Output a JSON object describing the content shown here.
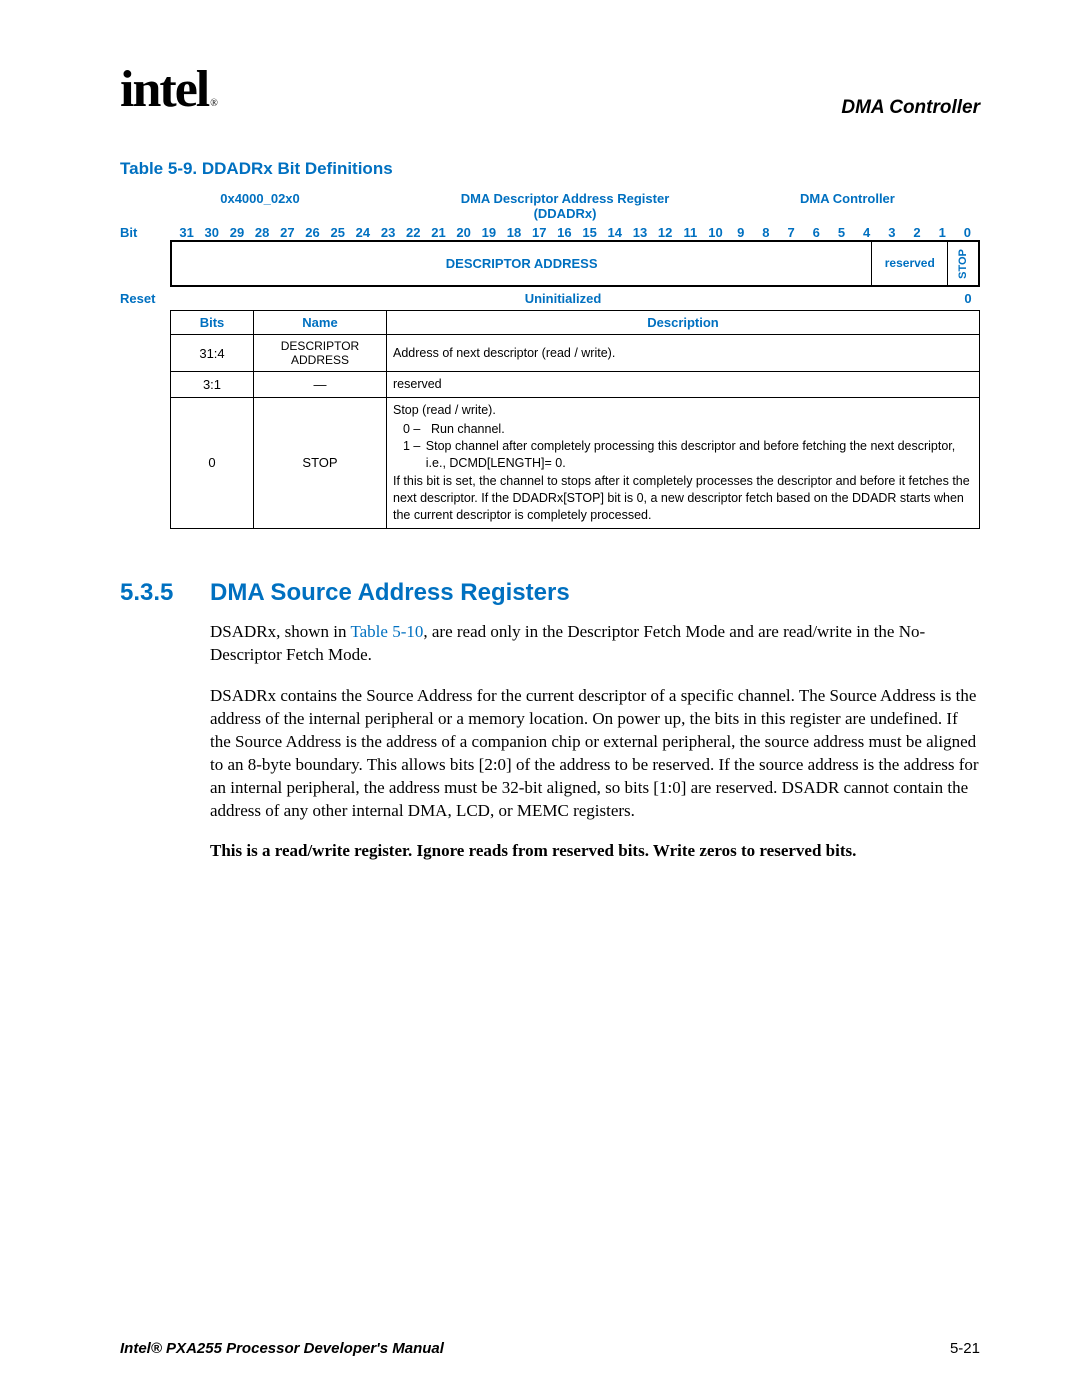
{
  "header": {
    "logo_text": "intel",
    "logo_reg": "®",
    "section": "DMA Controller"
  },
  "table": {
    "caption": "Table 5-9. DDADRx Bit Definitions",
    "address": "0x4000_02x0",
    "reg_name_line1": "DMA Descriptor Address Register",
    "reg_name_line2": "(DDADRx)",
    "module": "DMA Controller",
    "bit_label": "Bit",
    "bits": [
      "31",
      "30",
      "29",
      "28",
      "27",
      "26",
      "25",
      "24",
      "23",
      "22",
      "21",
      "20",
      "19",
      "18",
      "17",
      "16",
      "15",
      "14",
      "13",
      "12",
      "11",
      "10",
      "9",
      "8",
      "7",
      "6",
      "5",
      "4",
      "3",
      "2",
      "1",
      "0"
    ],
    "field_da": "DESCRIPTOR ADDRESS",
    "field_res": "reserved",
    "field_stop": "STOP",
    "reset_label": "Reset",
    "reset_value": "Uninitialized",
    "reset_bit0": "0",
    "columns": {
      "bits": "Bits",
      "name": "Name",
      "desc": "Description"
    },
    "rows": [
      {
        "bits": "31:4",
        "name": "DESCRIPTOR ADDRESS",
        "desc": "Address of next descriptor (read / write)."
      },
      {
        "bits": "3:1",
        "name": "—",
        "desc": "reserved"
      },
      {
        "bits": "0",
        "name": "STOP",
        "desc_intro": "Stop (read / write).",
        "opts": [
          {
            "k": "0 –",
            "v": "Run channel."
          },
          {
            "k": "1 –",
            "v": "Stop channel after completely processing this descriptor and before fetching the next descriptor, i.e., DCMD[LENGTH]= 0."
          }
        ],
        "desc_outro": "If this bit is set, the channel to stops after it completely processes the descriptor and before it fetches the next descriptor. If the DDADRx[STOP] bit is 0, a new descriptor fetch based on the DDADR starts when the current descriptor is completely processed."
      }
    ]
  },
  "section": {
    "num": "5.3.5",
    "title": "DMA Source Address Registers",
    "p1_a": "DSADRx, shown in ",
    "p1_link": "Table 5-10",
    "p1_b": ", are read only in the Descriptor Fetch Mode and are read/write in the No-Descriptor Fetch Mode.",
    "p2": "DSADRx contains the Source Address for the current descriptor of a specific channel. The Source Address is the address of the internal peripheral or a memory location. On power up, the bits in this register are undefined. If the Source Address is the address of a companion chip or external peripheral, the source address must be aligned to an 8-byte boundary. This allows bits [2:0] of the address to be reserved. If the source address is the address for an internal peripheral, the address must be 32-bit aligned, so bits [1:0] are reserved. DSADR cannot contain the address of any other internal DMA, LCD, or MEMC registers.",
    "p3": "This is a read/write register. Ignore reads from reserved bits. Write zeros to reserved bits."
  },
  "footer": {
    "left": "Intel® PXA255 Processor Developer's Manual",
    "right": "5-21"
  }
}
